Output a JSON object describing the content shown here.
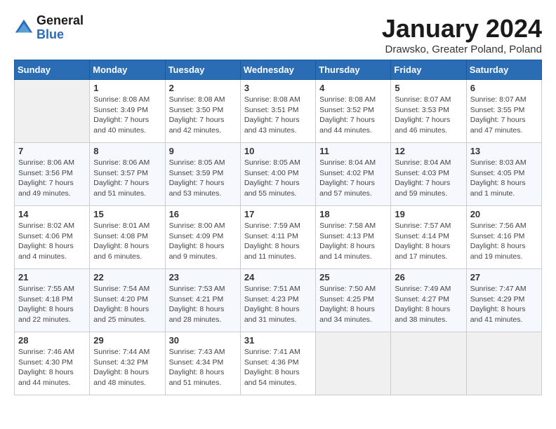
{
  "logo": {
    "general": "General",
    "blue": "Blue"
  },
  "title": "January 2024",
  "location": "Drawsko, Greater Poland, Poland",
  "days_of_week": [
    "Sunday",
    "Monday",
    "Tuesday",
    "Wednesday",
    "Thursday",
    "Friday",
    "Saturday"
  ],
  "weeks": [
    [
      {
        "day": "",
        "info": ""
      },
      {
        "day": "1",
        "info": "Sunrise: 8:08 AM\nSunset: 3:49 PM\nDaylight: 7 hours\nand 40 minutes."
      },
      {
        "day": "2",
        "info": "Sunrise: 8:08 AM\nSunset: 3:50 PM\nDaylight: 7 hours\nand 42 minutes."
      },
      {
        "day": "3",
        "info": "Sunrise: 8:08 AM\nSunset: 3:51 PM\nDaylight: 7 hours\nand 43 minutes."
      },
      {
        "day": "4",
        "info": "Sunrise: 8:08 AM\nSunset: 3:52 PM\nDaylight: 7 hours\nand 44 minutes."
      },
      {
        "day": "5",
        "info": "Sunrise: 8:07 AM\nSunset: 3:53 PM\nDaylight: 7 hours\nand 46 minutes."
      },
      {
        "day": "6",
        "info": "Sunrise: 8:07 AM\nSunset: 3:55 PM\nDaylight: 7 hours\nand 47 minutes."
      }
    ],
    [
      {
        "day": "7",
        "info": "Sunrise: 8:06 AM\nSunset: 3:56 PM\nDaylight: 7 hours\nand 49 minutes."
      },
      {
        "day": "8",
        "info": "Sunrise: 8:06 AM\nSunset: 3:57 PM\nDaylight: 7 hours\nand 51 minutes."
      },
      {
        "day": "9",
        "info": "Sunrise: 8:05 AM\nSunset: 3:59 PM\nDaylight: 7 hours\nand 53 minutes."
      },
      {
        "day": "10",
        "info": "Sunrise: 8:05 AM\nSunset: 4:00 PM\nDaylight: 7 hours\nand 55 minutes."
      },
      {
        "day": "11",
        "info": "Sunrise: 8:04 AM\nSunset: 4:02 PM\nDaylight: 7 hours\nand 57 minutes."
      },
      {
        "day": "12",
        "info": "Sunrise: 8:04 AM\nSunset: 4:03 PM\nDaylight: 7 hours\nand 59 minutes."
      },
      {
        "day": "13",
        "info": "Sunrise: 8:03 AM\nSunset: 4:05 PM\nDaylight: 8 hours\nand 1 minute."
      }
    ],
    [
      {
        "day": "14",
        "info": "Sunrise: 8:02 AM\nSunset: 4:06 PM\nDaylight: 8 hours\nand 4 minutes."
      },
      {
        "day": "15",
        "info": "Sunrise: 8:01 AM\nSunset: 4:08 PM\nDaylight: 8 hours\nand 6 minutes."
      },
      {
        "day": "16",
        "info": "Sunrise: 8:00 AM\nSunset: 4:09 PM\nDaylight: 8 hours\nand 9 minutes."
      },
      {
        "day": "17",
        "info": "Sunrise: 7:59 AM\nSunset: 4:11 PM\nDaylight: 8 hours\nand 11 minutes."
      },
      {
        "day": "18",
        "info": "Sunrise: 7:58 AM\nSunset: 4:13 PM\nDaylight: 8 hours\nand 14 minutes."
      },
      {
        "day": "19",
        "info": "Sunrise: 7:57 AM\nSunset: 4:14 PM\nDaylight: 8 hours\nand 17 minutes."
      },
      {
        "day": "20",
        "info": "Sunrise: 7:56 AM\nSunset: 4:16 PM\nDaylight: 8 hours\nand 19 minutes."
      }
    ],
    [
      {
        "day": "21",
        "info": "Sunrise: 7:55 AM\nSunset: 4:18 PM\nDaylight: 8 hours\nand 22 minutes."
      },
      {
        "day": "22",
        "info": "Sunrise: 7:54 AM\nSunset: 4:20 PM\nDaylight: 8 hours\nand 25 minutes."
      },
      {
        "day": "23",
        "info": "Sunrise: 7:53 AM\nSunset: 4:21 PM\nDaylight: 8 hours\nand 28 minutes."
      },
      {
        "day": "24",
        "info": "Sunrise: 7:51 AM\nSunset: 4:23 PM\nDaylight: 8 hours\nand 31 minutes."
      },
      {
        "day": "25",
        "info": "Sunrise: 7:50 AM\nSunset: 4:25 PM\nDaylight: 8 hours\nand 34 minutes."
      },
      {
        "day": "26",
        "info": "Sunrise: 7:49 AM\nSunset: 4:27 PM\nDaylight: 8 hours\nand 38 minutes."
      },
      {
        "day": "27",
        "info": "Sunrise: 7:47 AM\nSunset: 4:29 PM\nDaylight: 8 hours\nand 41 minutes."
      }
    ],
    [
      {
        "day": "28",
        "info": "Sunrise: 7:46 AM\nSunset: 4:30 PM\nDaylight: 8 hours\nand 44 minutes."
      },
      {
        "day": "29",
        "info": "Sunrise: 7:44 AM\nSunset: 4:32 PM\nDaylight: 8 hours\nand 48 minutes."
      },
      {
        "day": "30",
        "info": "Sunrise: 7:43 AM\nSunset: 4:34 PM\nDaylight: 8 hours\nand 51 minutes."
      },
      {
        "day": "31",
        "info": "Sunrise: 7:41 AM\nSunset: 4:36 PM\nDaylight: 8 hours\nand 54 minutes."
      },
      {
        "day": "",
        "info": ""
      },
      {
        "day": "",
        "info": ""
      },
      {
        "day": "",
        "info": ""
      }
    ]
  ]
}
